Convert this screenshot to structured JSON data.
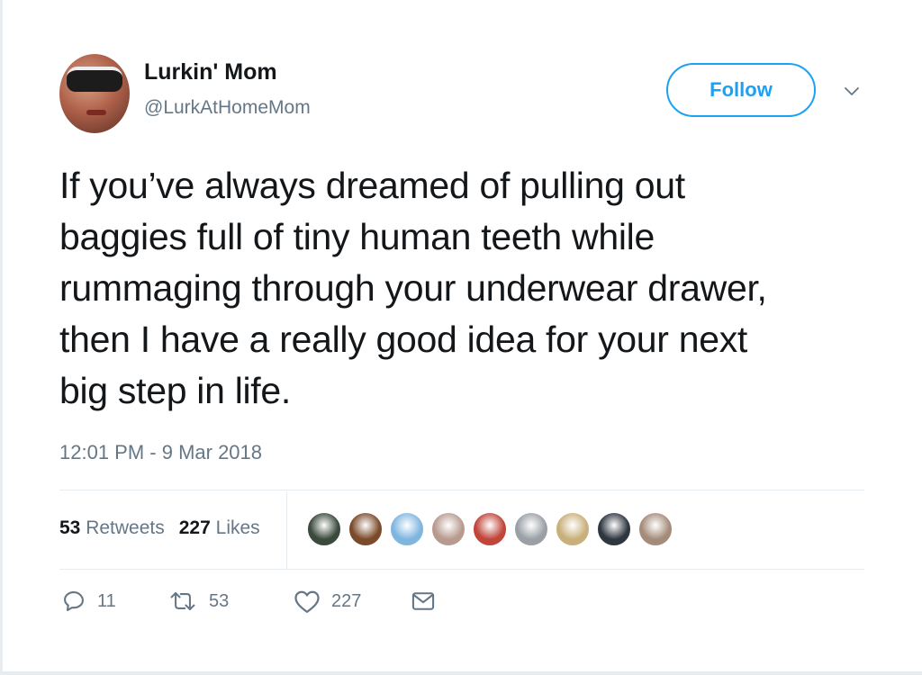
{
  "author": {
    "display_name": "Lurkin' Mom",
    "handle": "@LurkAtHomeMom"
  },
  "follow_button": {
    "label": "Follow"
  },
  "menu": {
    "icon": "chevron-down-icon"
  },
  "tweet": {
    "lines": [
      "If you’ve always dreamed of pulling out",
      "baggies full of tiny human teeth while",
      "rummaging through your underwear drawer,",
      "then I have a really good idea for your next",
      "big step in life."
    ],
    "timestamp": "12:01 PM - 9 Mar 2018"
  },
  "stats": {
    "retweets_count": "53",
    "retweets_label": "Retweets",
    "likes_count": "227",
    "likes_label": "Likes"
  },
  "liker_avatars": [
    {
      "color": "#3a4a3c",
      "icon": "avatar"
    },
    {
      "color": "#7a4a2a",
      "icon": "avatar"
    },
    {
      "color": "#7fb6e0",
      "icon": "avatar"
    },
    {
      "color": "#b89a8f",
      "icon": "avatar"
    },
    {
      "color": "#c0453a",
      "icon": "avatar"
    },
    {
      "color": "#9aa0a6",
      "icon": "avatar"
    },
    {
      "color": "#c9b07a",
      "icon": "avatar"
    },
    {
      "color": "#2e3640",
      "icon": "avatar"
    },
    {
      "color": "#a58b7a",
      "icon": "avatar"
    }
  ],
  "actions": {
    "reply": {
      "icon": "reply-icon",
      "count": "11"
    },
    "retweet": {
      "icon": "retweet-icon",
      "count": "53"
    },
    "like": {
      "icon": "heart-icon",
      "count": "227"
    },
    "message": {
      "icon": "envelope-icon"
    }
  },
  "colors": {
    "accent": "#1da1f2",
    "secondary_text": "#657786",
    "primary_text": "#14171a",
    "divider": "#e6ecf0"
  }
}
